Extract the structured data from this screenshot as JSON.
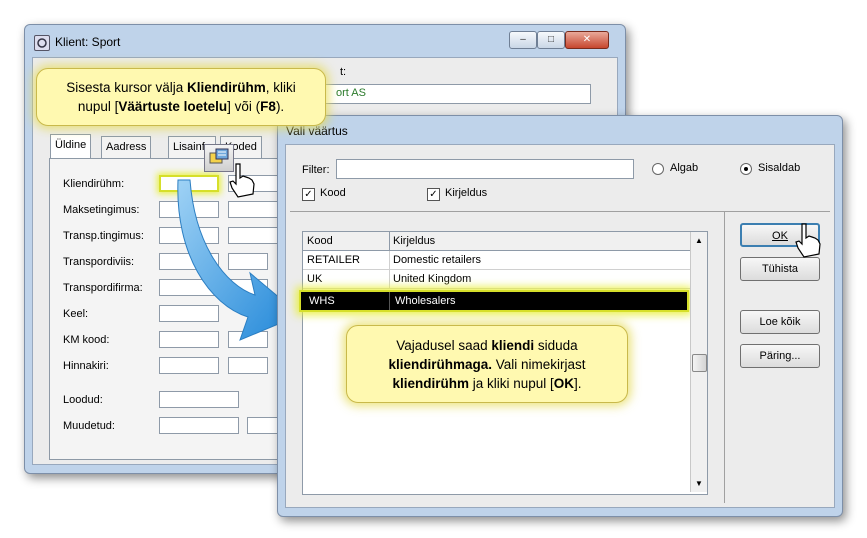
{
  "back_window": {
    "title": "Klient: Sport",
    "caption_minimize": "‒",
    "caption_maximize": "□",
    "caption_close": "✕",
    "name_value": "ort AS",
    "name_label_fragment": "t:",
    "tabs": [
      "Üldine",
      "Aadress",
      "Lisainfo",
      "Koded"
    ],
    "fields": [
      {
        "label": "Kliendirühm:"
      },
      {
        "label": "Maksetingimus:"
      },
      {
        "label": "Transp.tingimus:"
      },
      {
        "label": "Transpordiviis:"
      },
      {
        "label": "Transpordifirma:"
      },
      {
        "label": "Keel:"
      },
      {
        "label": "KM kood:"
      },
      {
        "label": "Hinnakiri:"
      }
    ],
    "loodud_label": "Loodud:",
    "muudetud_label": "Muudetud:"
  },
  "front_window": {
    "title": "Vali väärtus",
    "filter_label": "Filter:",
    "radio_algab": "Algab",
    "radio_sisaldab": "Sisaldab",
    "check_kood": "Kood",
    "check_kirjeldus": "Kirjeldus",
    "columns": [
      "Kood",
      "Kirjeldus"
    ],
    "rows": [
      {
        "code": "RETAILER",
        "desc": "Domestic retailers"
      },
      {
        "code": "UK",
        "desc": "United Kingdom"
      },
      {
        "code": "WHS",
        "desc": "Wholesalers"
      }
    ],
    "btn_ok": "OK",
    "btn_cancel": "Tühista",
    "btn_load_all": "Loe kõik",
    "btn_query": "Päring..."
  },
  "callout_top": {
    "line1_a": "Sisesta kursor välja ",
    "line1_b": "Kliendirühm",
    "line1_c": ", kliki",
    "line2_a": "nupul [",
    "line2_b": "Väärtuste loetelu",
    "line2_c": "] või (",
    "line2_d": "F8",
    "line2_e": ")."
  },
  "callout_bottom": {
    "l1_a": "Vajadusel saad ",
    "l1_b": "kliendi",
    "l1_c": " siduda",
    "l2_a": "kliendirühmaga.",
    "l2_b": " Vali nimekirjast",
    "l3_a": "kliendirühm",
    "l3_b": " ja kliki nupul [",
    "l3_c": "OK",
    "l3_d": "]."
  },
  "colors": {
    "highlight_row": "#000000",
    "highlight_glow": "#e8ef3a",
    "arrow": "#3aa0e6",
    "callout_bg": "#fff9b0"
  }
}
